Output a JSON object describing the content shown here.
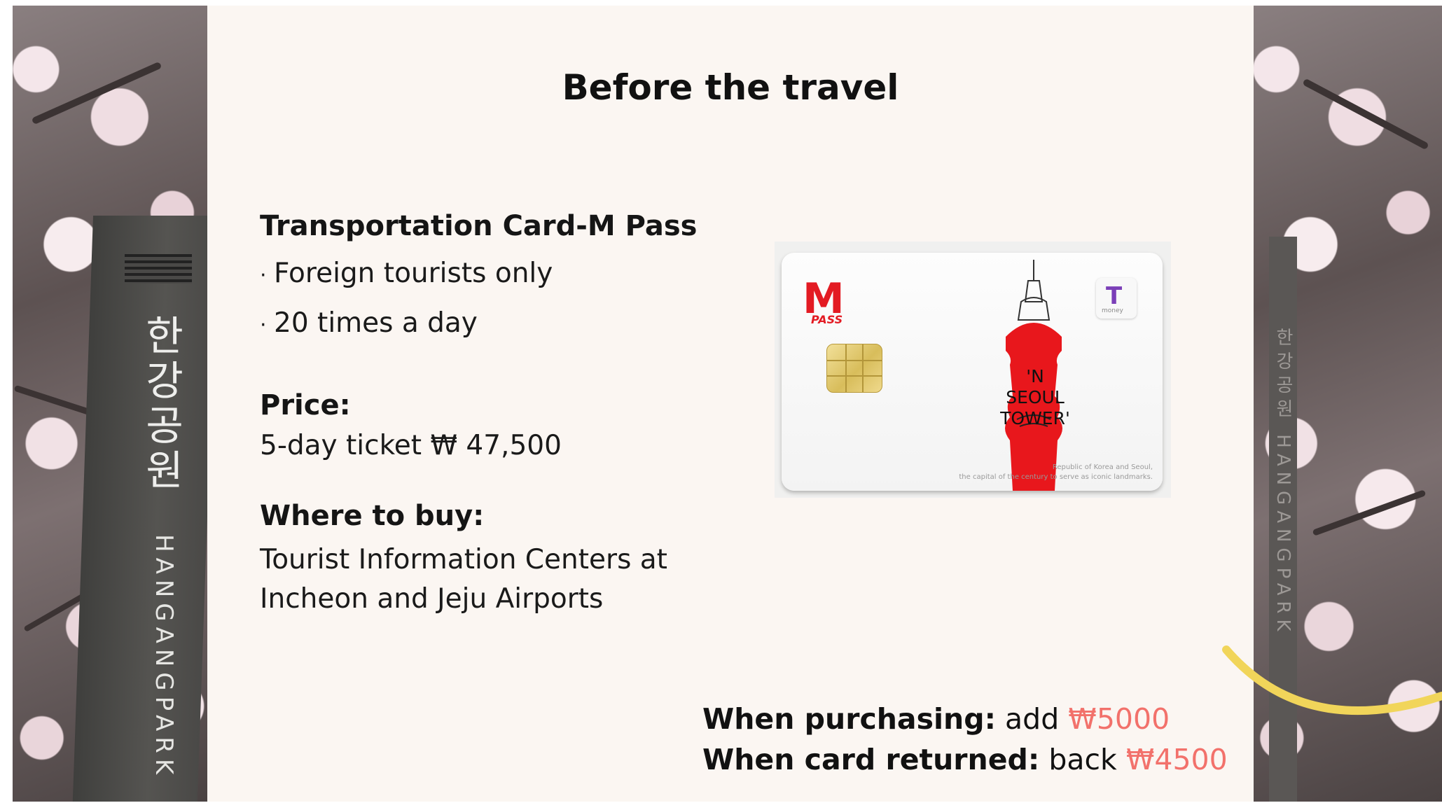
{
  "slide": {
    "title": "Before the travel",
    "card_section": {
      "heading": "Transportation Card-M Pass",
      "bullets": [
        "Foreign tourists only",
        "20 times a day"
      ]
    },
    "price": {
      "label": "Price:",
      "value": "5-day ticket ₩ 47,500"
    },
    "where_to_buy": {
      "label": "Where to buy:",
      "lines": [
        "Tourist Information Centers at",
        "Incheon and Jeju Airports"
      ]
    },
    "notes": {
      "purchase": {
        "label": "When purchasing:",
        "text": "add",
        "amount": "₩5000"
      },
      "return": {
        "label": "When card returned:",
        "text": "back",
        "amount": "₩4500"
      }
    }
  },
  "card_image": {
    "logo_letter": "M",
    "logo_sub": "PASS",
    "tmoney_letter": "T",
    "tmoney_sub": "money",
    "tower_text": [
      "'N",
      "SEOUL",
      "TOWER'"
    ],
    "fine_print": [
      "Republic of Korea and Seoul,",
      "the capital of the century to serve as iconic landmarks."
    ]
  },
  "signs": {
    "left_korean": "한강공원",
    "left_latin": "HANGANGPARK",
    "right_latin": "한강공원 HANGANGPARK"
  },
  "colors": {
    "background": "#fbf6f2",
    "text": "#111111",
    "amount_accent": "#f2716b",
    "logo_red": "#e31b23",
    "tmoney_purple": "#7b3fb8",
    "arc_yellow": "#f1d55a"
  },
  "icons": {
    "bullet": "middle-dot",
    "card_chip": "chip-icon",
    "card_logo": "m-pass-logo",
    "tmoney_logo": "tmoney-logo"
  }
}
